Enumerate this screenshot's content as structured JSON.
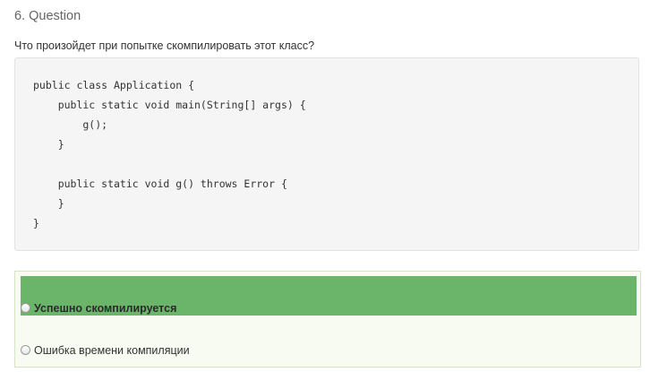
{
  "question": {
    "number_title": "6. Question",
    "text": "Что произойдет при попытке скомпилировать этот класс?"
  },
  "code": {
    "lines": [
      "public class Application {",
      "    public static void main(String[] args) {",
      "        g();",
      "    }",
      "",
      "    public static void g() throws Error {",
      "    }",
      "}"
    ]
  },
  "answers": [
    {
      "label": "Успешно скомпилируется",
      "selected": false,
      "state": "correct"
    },
    {
      "label": "Ошибка времени компиляции",
      "selected": false,
      "state": "normal"
    }
  ],
  "colors": {
    "correct_highlight": "#6bb56b",
    "answers_background": "#f7fbf1",
    "code_background": "#f5f5f5"
  }
}
